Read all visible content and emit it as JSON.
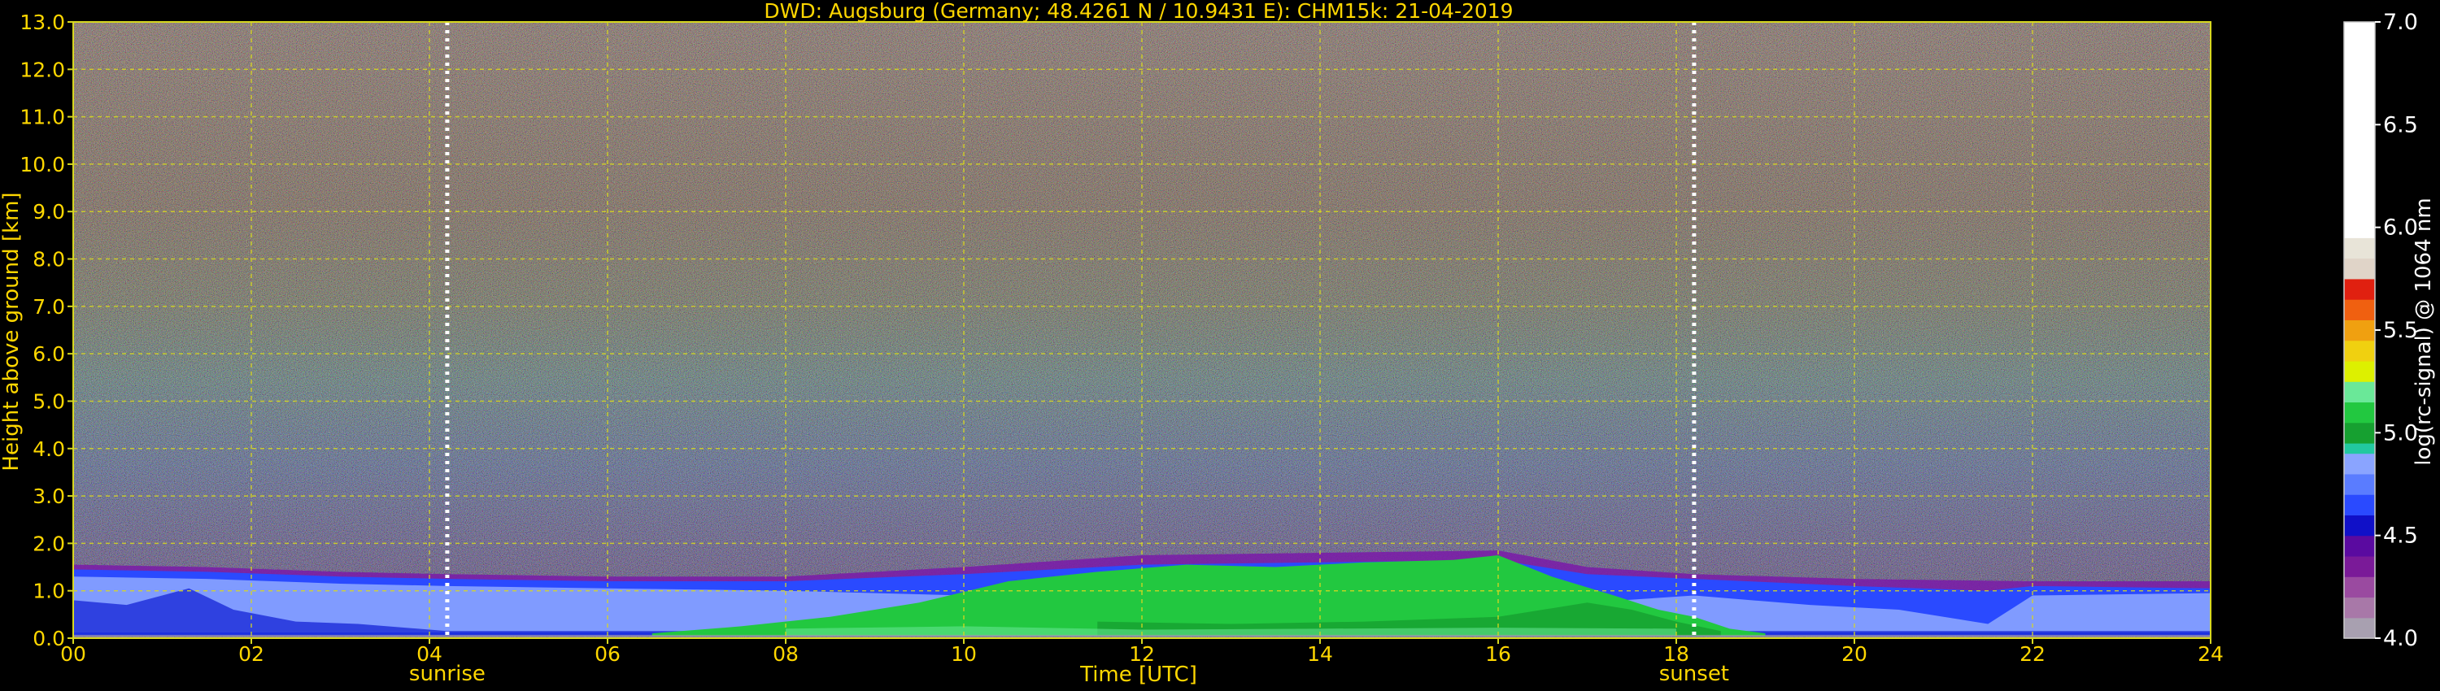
{
  "chart_data": {
    "type": "heatmap",
    "title": "DWD: Augsburg (Germany; 48.4261 N / 10.9431 E):    CHM15k: 21-04-2019",
    "xlabel": "Time [UTC]",
    "ylabel": "Height above ground [km]",
    "xlim": [
      0,
      24
    ],
    "ylim": [
      0,
      13
    ],
    "x_ticks": [
      "00",
      "02",
      "04",
      "06",
      "08",
      "10",
      "12",
      "14",
      "16",
      "18",
      "20",
      "22",
      "24"
    ],
    "y_ticks": [
      "0.0",
      "1.0",
      "2.0",
      "3.0",
      "4.0",
      "5.0",
      "6.0",
      "7.0",
      "8.0",
      "9.0",
      "10.0",
      "11.0",
      "12.0",
      "13.0"
    ],
    "grid": true,
    "markers": [
      {
        "label": "sunrise",
        "x": 4.2
      },
      {
        "label": "sunset",
        "x": 18.2
      }
    ],
    "colorbar": {
      "label": "log(rc-signal) @ 1064 nm",
      "range": [
        4.0,
        7.0
      ],
      "ticks": [
        "4.0",
        "4.5",
        "5.0",
        "5.5",
        "6.0",
        "6.5",
        "7.0"
      ],
      "levels": [
        {
          "from": 4.0,
          "to": 4.1,
          "color": "#a8a0b0"
        },
        {
          "from": 4.1,
          "to": 4.2,
          "color": "#a878a8"
        },
        {
          "from": 4.2,
          "to": 4.3,
          "color": "#9a4aa0"
        },
        {
          "from": 4.3,
          "to": 4.4,
          "color": "#7a1a98"
        },
        {
          "from": 4.4,
          "to": 4.5,
          "color": "#5a0aa0"
        },
        {
          "from": 4.5,
          "to": 4.6,
          "color": "#1010c8"
        },
        {
          "from": 4.6,
          "to": 4.7,
          "color": "#2a4aff"
        },
        {
          "from": 4.7,
          "to": 4.8,
          "color": "#5a7cff"
        },
        {
          "from": 4.8,
          "to": 4.9,
          "color": "#8aa4ff"
        },
        {
          "from": 4.9,
          "to": 4.95,
          "color": "#22c8a0"
        },
        {
          "from": 4.95,
          "to": 5.05,
          "color": "#16a030"
        },
        {
          "from": 5.05,
          "to": 5.15,
          "color": "#22c840"
        },
        {
          "from": 5.15,
          "to": 5.25,
          "color": "#6ae898"
        },
        {
          "from": 5.25,
          "to": 5.35,
          "color": "#ddf000"
        },
        {
          "from": 5.35,
          "to": 5.45,
          "color": "#f0d010"
        },
        {
          "from": 5.45,
          "to": 5.55,
          "color": "#f0a010"
        },
        {
          "from": 5.55,
          "to": 5.65,
          "color": "#f06010"
        },
        {
          "from": 5.65,
          "to": 5.75,
          "color": "#e02010"
        },
        {
          "from": 5.75,
          "to": 5.85,
          "color": "#e0d4c8"
        },
        {
          "from": 5.85,
          "to": 5.95,
          "color": "#e8e4d8"
        },
        {
          "from": 5.95,
          "to": 7.0,
          "color": "#ffffff"
        }
      ]
    },
    "colors": {
      "text": "#ffd700",
      "grid": "#d8d820",
      "background": "#000000",
      "colorbar_text": "#ffffff"
    }
  }
}
